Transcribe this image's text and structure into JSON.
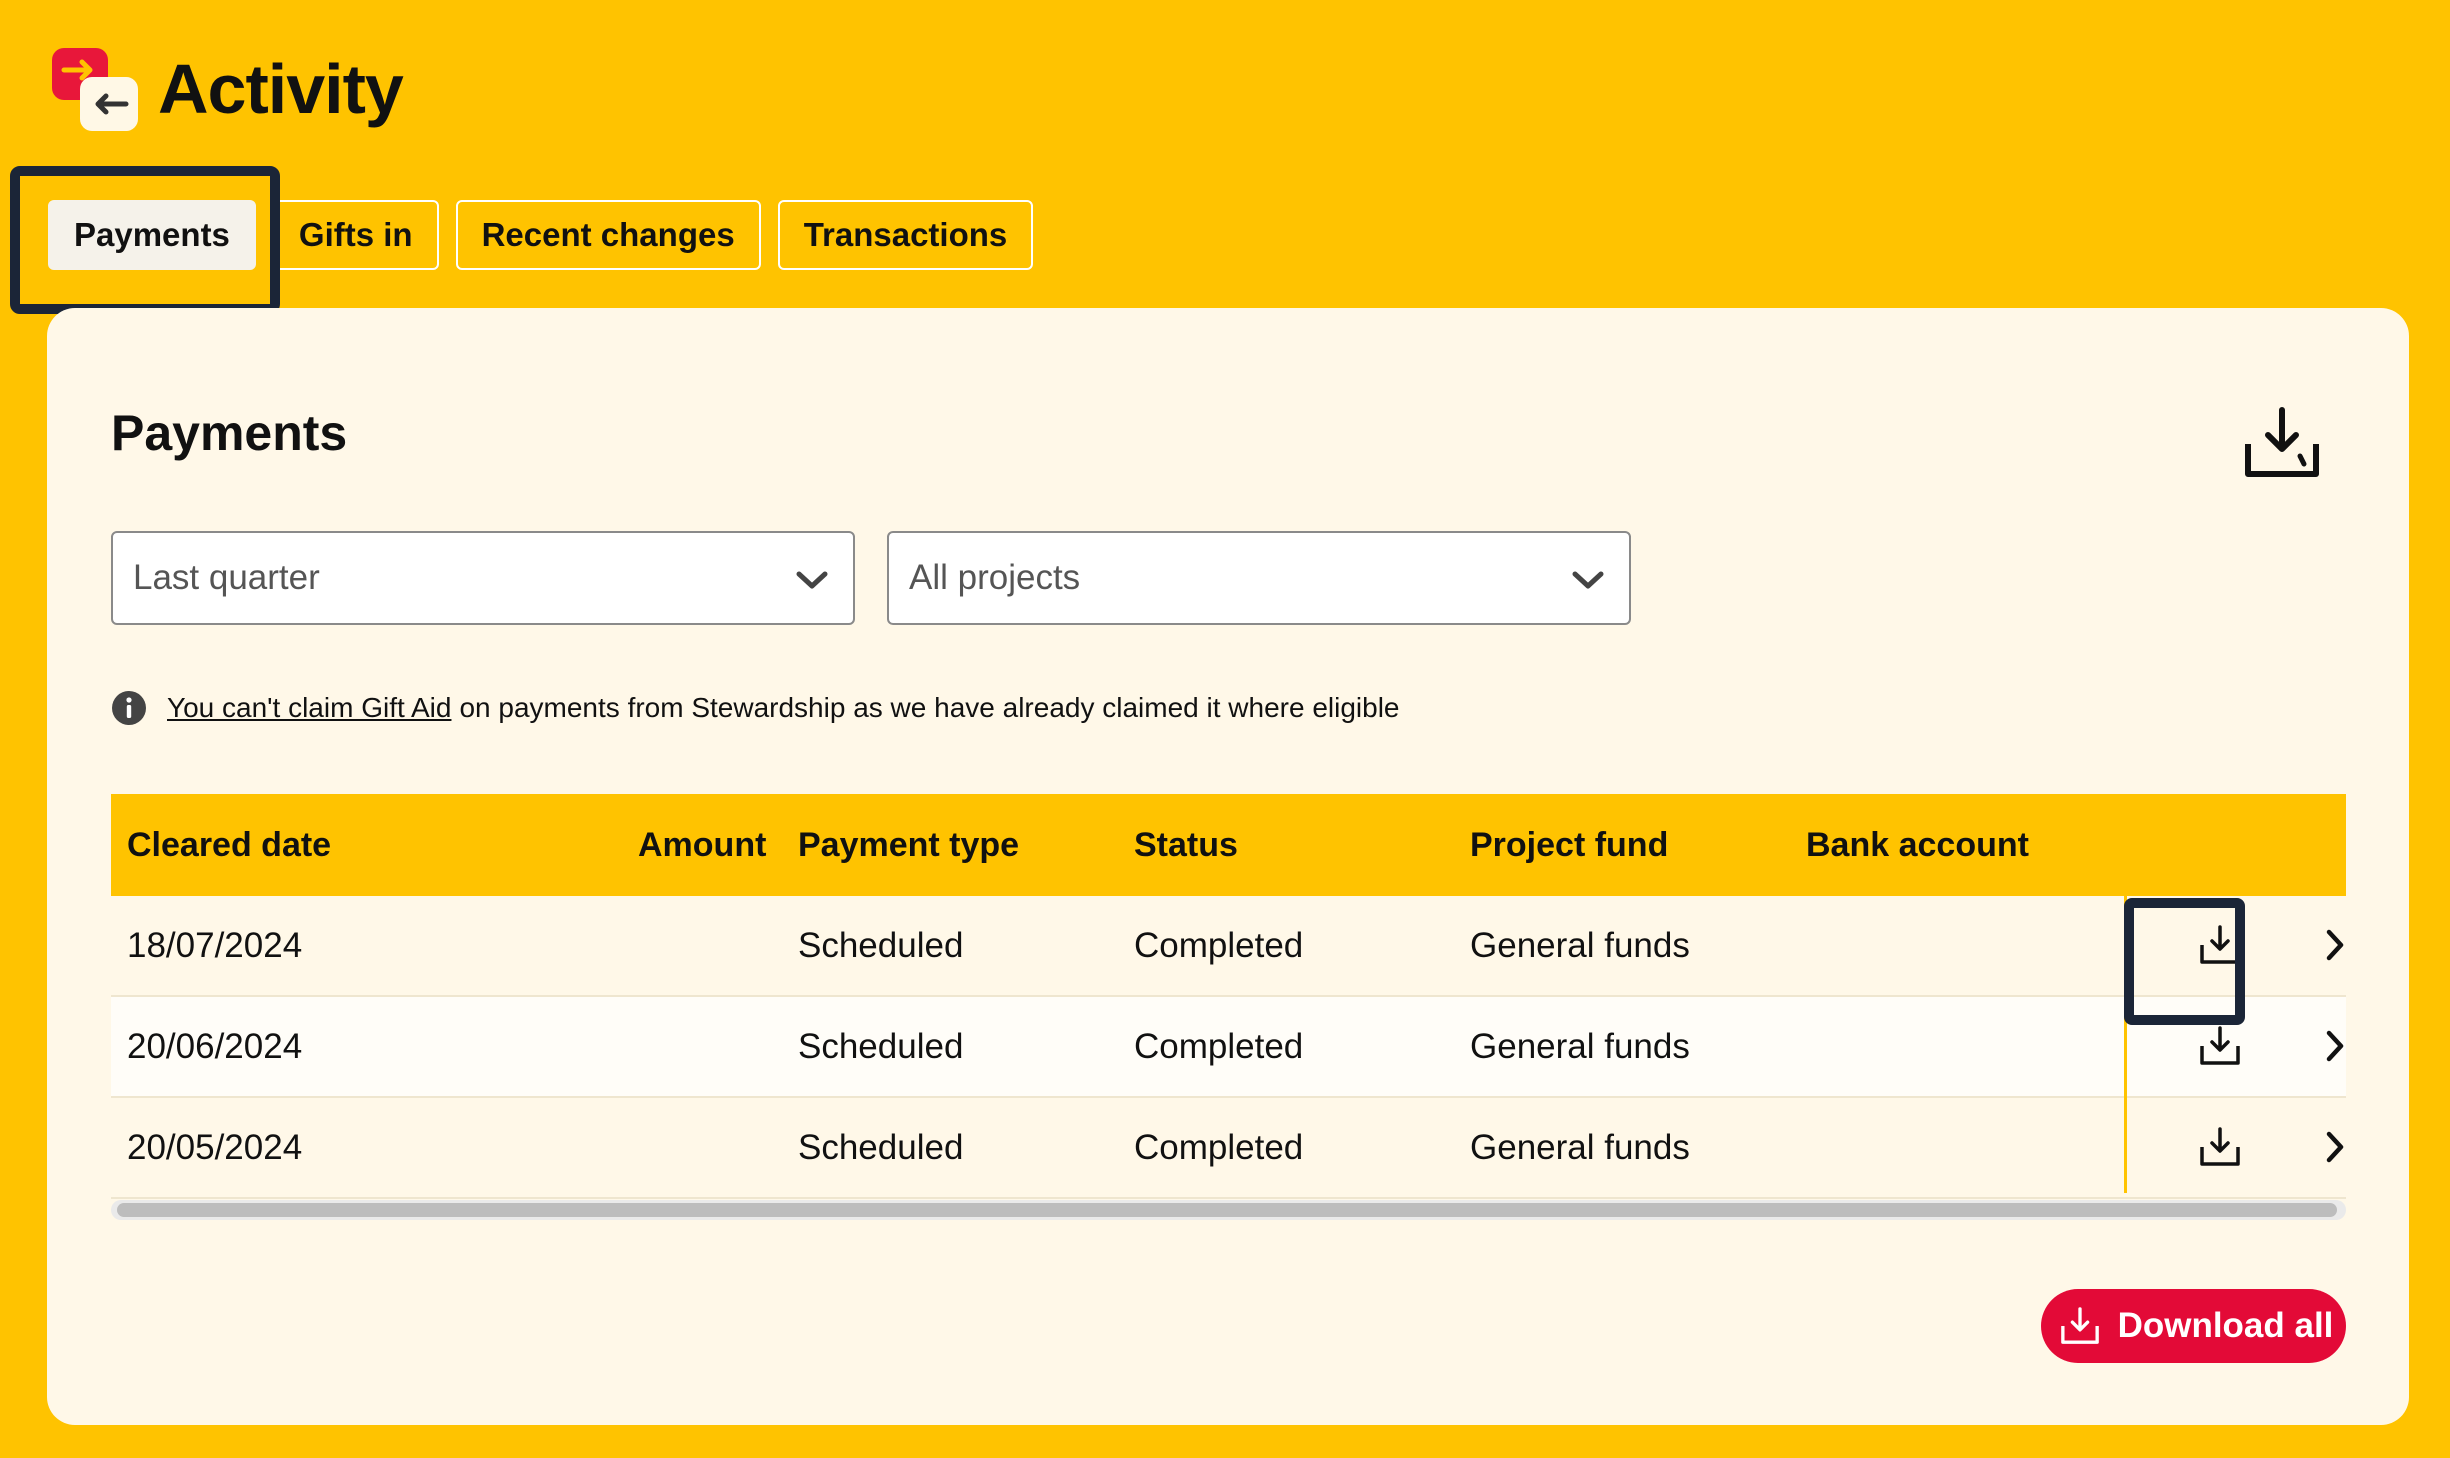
{
  "header": {
    "title": "Activity",
    "logo_icon": "activity-arrows-icon"
  },
  "tabs": [
    {
      "label": "Payments",
      "active": true
    },
    {
      "label": "Gifts in",
      "active": false
    },
    {
      "label": "Recent changes",
      "active": false
    },
    {
      "label": "Transactions",
      "active": false
    }
  ],
  "card": {
    "title": "Payments",
    "download_icon": "download-icon"
  },
  "filters": {
    "period": {
      "value": "Last quarter"
    },
    "project": {
      "value": "All projects"
    }
  },
  "info": {
    "icon": "info-icon",
    "link_text": "You can't claim Gift Aid",
    "text": "on payments from Stewardship as we have already claimed it where eligible"
  },
  "table": {
    "columns": [
      "Cleared date",
      "Amount",
      "Payment type",
      "Status",
      "Project fund",
      "Bank account"
    ],
    "rows": [
      {
        "cleared_date": "18/07/2024",
        "amount": "",
        "payment_type": "Scheduled",
        "status": "Completed",
        "project_fund": "General funds",
        "bank_account": ""
      },
      {
        "cleared_date": "20/06/2024",
        "amount": "",
        "payment_type": "Scheduled",
        "status": "Completed",
        "project_fund": "General funds",
        "bank_account": ""
      },
      {
        "cleared_date": "20/05/2024",
        "amount": "",
        "payment_type": "Scheduled",
        "status": "Completed",
        "project_fund": "General funds",
        "bank_account": ""
      }
    ]
  },
  "actions": {
    "download_all_label": "Download all"
  },
  "colors": {
    "background": "#FFC300",
    "card": "#FFF8E8",
    "accent": "#E30A37",
    "focus": "#1B2537"
  }
}
